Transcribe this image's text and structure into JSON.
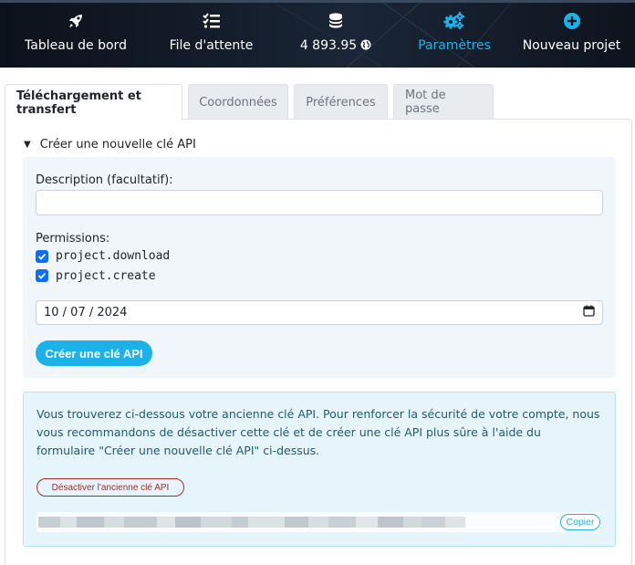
{
  "nav": {
    "items": [
      {
        "label": "Tableau de bord",
        "icon": "rocket-icon"
      },
      {
        "label": "File d'attente",
        "icon": "tasks-icon"
      },
      {
        "label": "4 893.95",
        "icon": "coins-icon",
        "suffix_icon": "globe-icon"
      },
      {
        "label": "Paramètres",
        "icon": "cogs-icon",
        "active": true
      },
      {
        "label": "Nouveau projet",
        "icon": "plus-circle-icon"
      }
    ]
  },
  "tabs": [
    {
      "label": "Téléchargement et transfert",
      "active": true
    },
    {
      "label": "Coordonnées"
    },
    {
      "label": "Préférences"
    },
    {
      "label": "Mot de passe"
    }
  ],
  "api_form": {
    "summary": "Créer une nouvelle clé API",
    "description_label": "Description (facultatif):",
    "description_value": "",
    "permissions_label": "Permissions:",
    "permissions": [
      {
        "name": "project.download",
        "checked": true
      },
      {
        "name": "project.create",
        "checked": true
      }
    ],
    "date_value": "10 / 07 / 2024",
    "submit_label": "Créer une clé API"
  },
  "old_key": {
    "message": "Vous trouverez ci-dessous votre ancienne clé API. Pour renforcer la sécurité de votre compte, nous vous recommandons de désactiver cette clé et de créer une clé API plus sûre à l'aide du formulaire \"Créer une nouvelle clé API\" ci-dessus.",
    "deactivate_label": "Désactiver l'ancienne clé API",
    "copy_label": "Copier"
  },
  "colors": {
    "accent": "#1ab2e8",
    "primary_check": "#0d6efd",
    "danger": "#a52a2a",
    "info_bg": "#e6f5fc"
  }
}
